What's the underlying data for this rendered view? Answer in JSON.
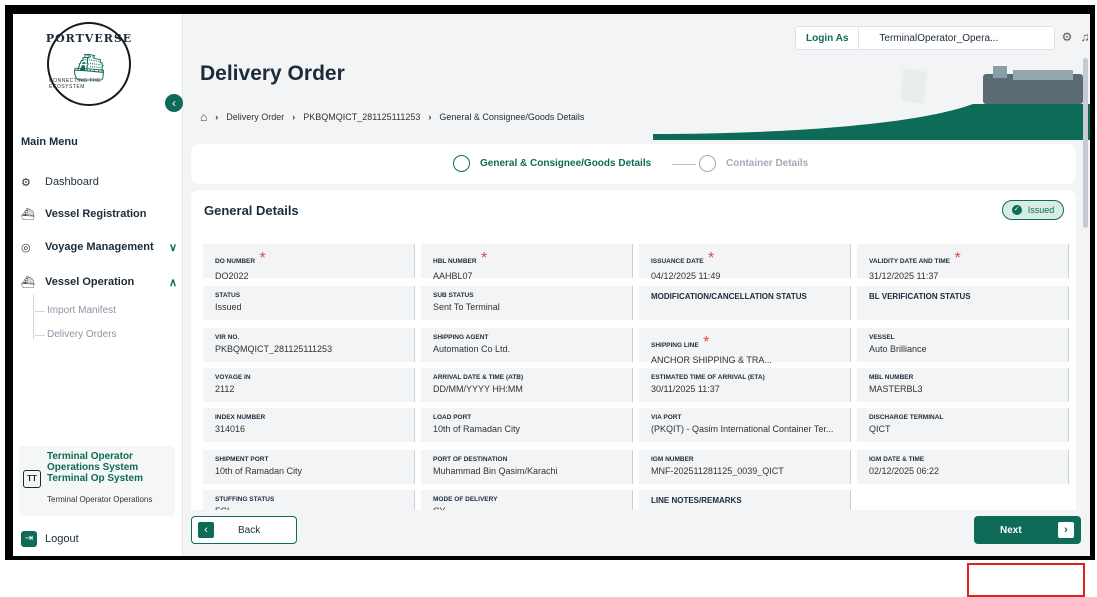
{
  "sidebar": {
    "logo": {
      "brand": "PORTVERSE",
      "tagline": "CONNECTING THE ECOSYSTEM"
    },
    "main_menu_title": "Main Menu",
    "items": [
      {
        "label": "Dashboard",
        "icon": "dashboard-icon"
      },
      {
        "label": "Vessel Registration",
        "icon": "ship-icon"
      },
      {
        "label": "Voyage Management",
        "icon": "compass-icon",
        "chevron": "∨"
      },
      {
        "label": "Vessel Operation",
        "icon": "vessel-icon",
        "chevron": "∧"
      }
    ],
    "sub_items": [
      {
        "label": "Import Manifest"
      },
      {
        "label": "Delivery Orders"
      }
    ],
    "user": {
      "initials": "TT",
      "role": "Terminal Operator Operations System Terminal Op System",
      "sub": "Terminal Operator Operations"
    },
    "logout_label": "Logout"
  },
  "topbar": {
    "login_as_label": "Login As",
    "login_as_user": "TerminalOperator_Opera..."
  },
  "header": {
    "title": "Delivery Order",
    "breadcrumb": [
      "Delivery Order",
      "PKBQMQICT_281125111253",
      "General & Consignee/Goods Details"
    ]
  },
  "stepper": {
    "steps": [
      {
        "label": "General & Consignee/Goods Details",
        "active": true
      },
      {
        "label": "Container Details",
        "active": false
      }
    ]
  },
  "general_details": {
    "title": "General Details",
    "status_badge": "Issued",
    "fields": [
      {
        "label": "DO NUMBER",
        "required": true,
        "value": "DO2022"
      },
      {
        "label": "HBL NUMBER",
        "required": true,
        "value": "AAHBL07"
      },
      {
        "label": "ISSUANCE DATE",
        "required": true,
        "value": "04/12/2025 11:49"
      },
      {
        "label": "VALIDITY DATE AND TIME",
        "required": true,
        "value": "31/12/2025 11:37"
      },
      {
        "label": "STATUS",
        "required": false,
        "value": "Issued"
      },
      {
        "label": "SUB STATUS",
        "required": false,
        "value": "Sent To Terminal"
      },
      {
        "label": "MODIFICATION/CANCELLATION STATUS",
        "required": false,
        "value": ""
      },
      {
        "label": "BL VERIFICATION STATUS",
        "required": false,
        "value": ""
      },
      {
        "label": "VIR NO.",
        "required": false,
        "value": "PKBQMQICT_281125111253"
      },
      {
        "label": "SHIPPING AGENT",
        "required": false,
        "value": "Automation Co Ltd."
      },
      {
        "label": "SHIPPING LINE",
        "required": true,
        "value": "ANCHOR SHIPPING & TRA..."
      },
      {
        "label": "VESSEL",
        "required": false,
        "value": "Auto Brilliance"
      },
      {
        "label": "VOYAGE IN",
        "required": false,
        "value": "2112"
      },
      {
        "label": "ARRIVAL DATE & TIME (ATB)",
        "required": false,
        "value": "DD/MM/YYYY HH:MM"
      },
      {
        "label": "ESTIMATED TIME OF ARRIVAL (ETA)",
        "required": false,
        "value": "30/11/2025 11:37"
      },
      {
        "label": "MBL NUMBER",
        "required": false,
        "value": "MASTERBL3"
      },
      {
        "label": "INDEX NUMBER",
        "required": false,
        "value": "314016"
      },
      {
        "label": "LOAD PORT",
        "required": false,
        "value": "10th of Ramadan City"
      },
      {
        "label": "VIA PORT",
        "required": false,
        "value": "(PKQIT) - Qasim International Container Ter..."
      },
      {
        "label": "DISCHARGE TERMINAL",
        "required": false,
        "value": "QICT"
      },
      {
        "label": "SHIPMENT PORT",
        "required": false,
        "value": "10th of Ramadan City"
      },
      {
        "label": "PORT OF DESTINATION",
        "required": false,
        "value": "Muhammad Bin Qasim/Karachi"
      },
      {
        "label": "IGM NUMBER",
        "required": false,
        "value": "MNF-202511281125_0039_QICT"
      },
      {
        "label": "IGM DATE & TIME",
        "required": false,
        "value": "02/12/2025 06:22"
      },
      {
        "label": "STUFFING STATUS",
        "required": false,
        "value": "FCL"
      },
      {
        "label": "MODE OF DELIVERY",
        "required": false,
        "value": "CY"
      },
      {
        "label": "LINE NOTES/REMARKS",
        "required": false,
        "value": ""
      }
    ]
  },
  "footer": {
    "back_label": "Back",
    "next_label": "Next"
  },
  "colors": {
    "primary": "#0e6b57",
    "badge_bg": "#d6ede6",
    "page_bg": "#f2f4f6",
    "highlight": "#e02020"
  }
}
